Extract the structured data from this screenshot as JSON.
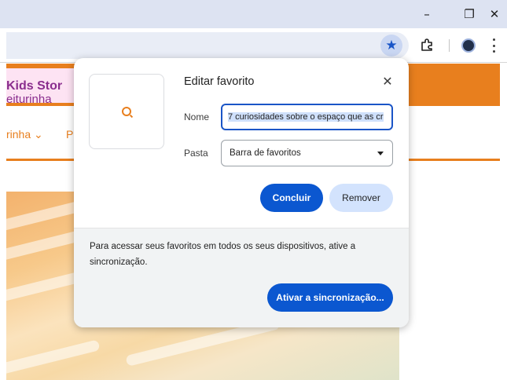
{
  "window": {
    "minimize": "–",
    "restore": "❐",
    "close": "✕"
  },
  "toolbar": {
    "bookmark_icon": "★"
  },
  "page": {
    "brand_title": "Kids Stor",
    "brand_subtitle": "eiturinha",
    "nav_item_1": "rinha ⌄",
    "nav_item_2": "P"
  },
  "dialog": {
    "title": "Editar favorito",
    "close_icon": "✕",
    "name_label": "Nome",
    "name_value": "7 curiosidades sobre o espaço que as cr",
    "folder_label": "Pasta",
    "folder_value": "Barra de favoritos",
    "done_label": "Concluir",
    "remove_label": "Remover",
    "sync_message": "Para acessar seus favoritos em todos os seus dispositivos, ative a sincronização.",
    "sync_button": "Ativar a sincronização..."
  },
  "colors": {
    "accent": "#0b57d0",
    "site_orange": "#e87f1e",
    "site_purple": "#8a2e8e"
  }
}
